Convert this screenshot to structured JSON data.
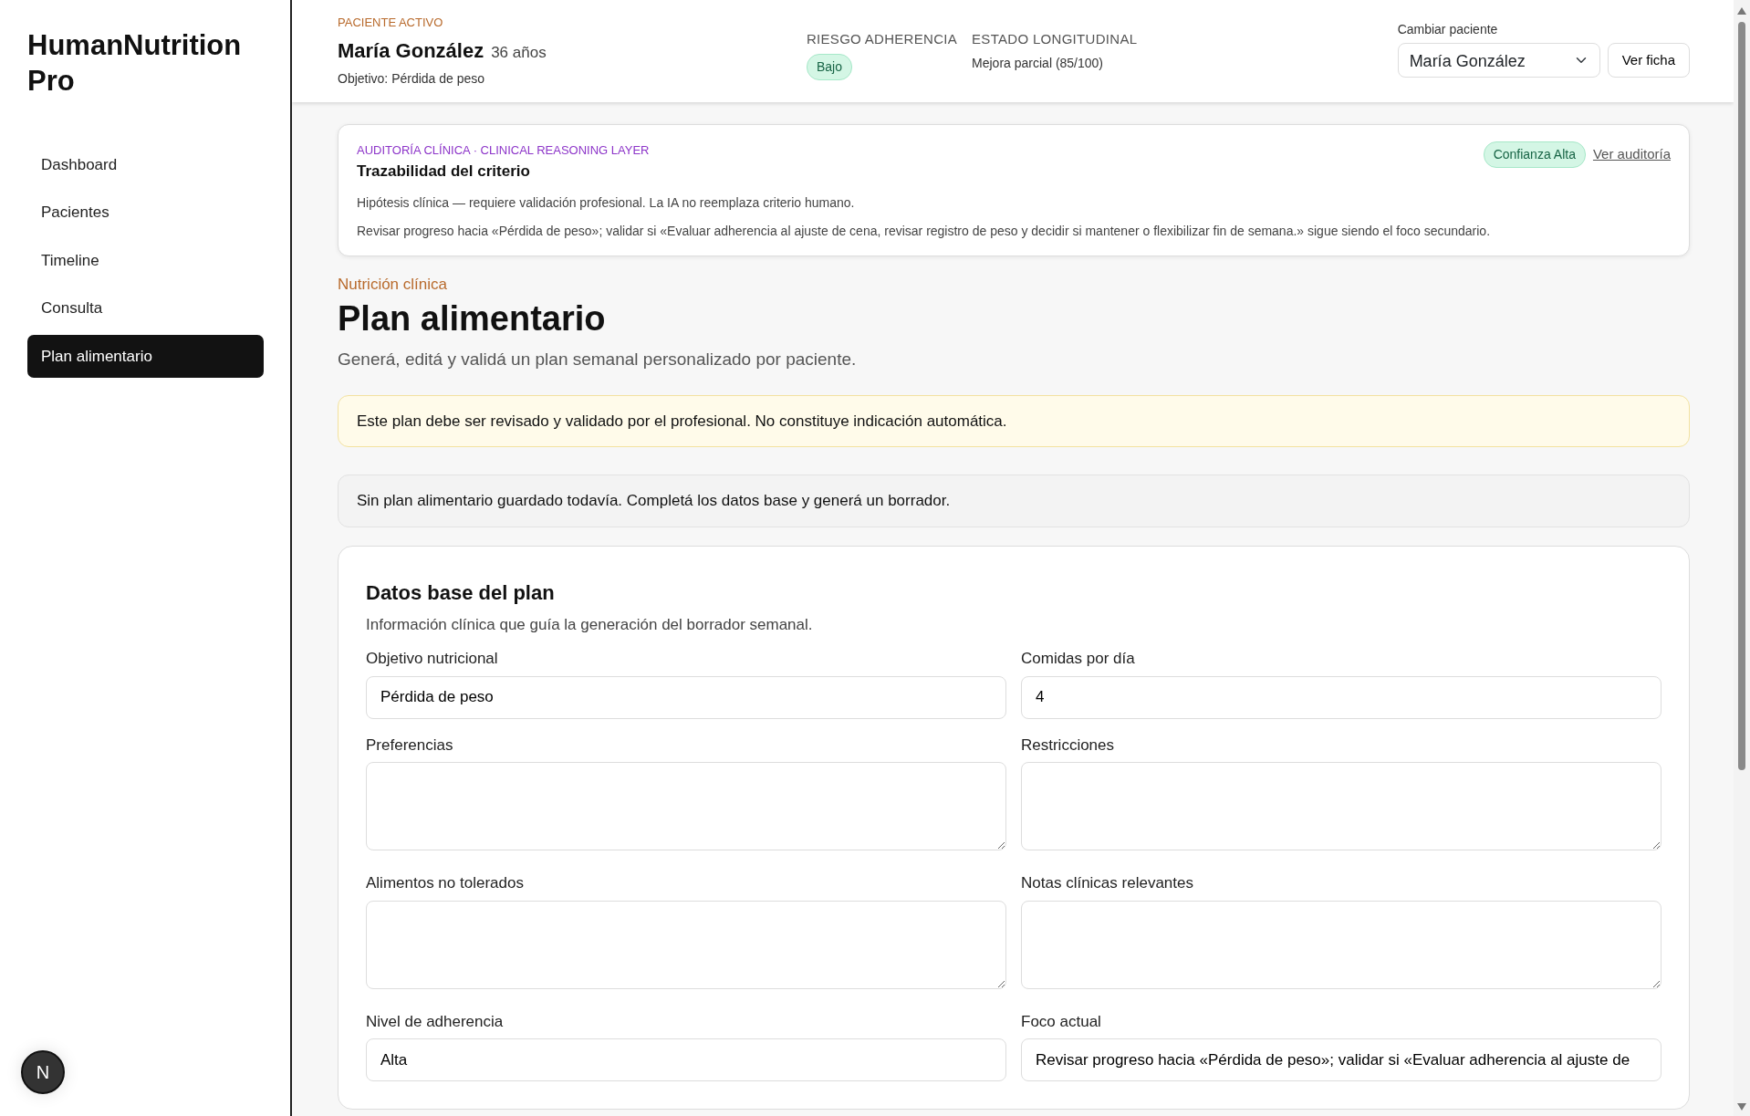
{
  "sidebar": {
    "brand": "HumanNutrition Pro",
    "items": [
      {
        "label": "Dashboard",
        "selected": false
      },
      {
        "label": "Pacientes",
        "selected": false
      },
      {
        "label": "Timeline",
        "selected": false
      },
      {
        "label": "Consulta",
        "selected": false
      },
      {
        "label": "Plan alimentario",
        "selected": true
      }
    ],
    "avatar": "N"
  },
  "header": {
    "eyebrow": "PACIENTE ACTIVO",
    "patient": "María González",
    "age": "36 años",
    "objective": "Objetivo: Pérdida de peso",
    "stats": [
      {
        "kind": "badge",
        "label": "RIESGO ADHERENCIA",
        "value": "Bajo"
      },
      {
        "kind": "text",
        "label": "ESTADO LONGITUDINAL",
        "value": "Mejora parcial (85/100)"
      }
    ],
    "switch_label": "Cambiar paciente",
    "switch_value": "María González",
    "view_button": "Ver ficha"
  },
  "audit": {
    "eyebrow": "AUDITORÍA CLÍNICA · CLINICAL REASONING LAYER",
    "title": "Trazabilidad del criterio",
    "badge": "Confianza Alta",
    "link": "Ver auditoría",
    "lines": [
      "Hipótesis clínica — requiere validación profesional. La IA no reemplaza criterio humano.",
      "Revisar progreso hacia «Pérdida de peso»; validar si «Evaluar adherencia al ajuste de cena, revisar registro de peso y decidir si mantener o flexibilizar fin de semana.» sigue siendo el foco secundario."
    ]
  },
  "page": {
    "eyebrow": "Nutrición clínica",
    "title": "Plan alimentario",
    "subtitle": "Generá, editá y validá un plan semanal personalizado por paciente."
  },
  "alerts": [
    {
      "kind": "warning",
      "text": "Este plan debe ser revisado y validado por el profesional. No constituye indicación automática."
    },
    {
      "kind": "info",
      "text": "Sin plan alimentario guardado todavía. Completá los datos base y generá un borrador."
    }
  ],
  "form": {
    "title": "Datos base del plan",
    "description": "Información clínica que guía la generación del borrador semanal.",
    "fields": [
      {
        "kind": "input",
        "label": "Objetivo nutricional",
        "value": "Pérdida de peso"
      },
      {
        "kind": "input",
        "label": "Comidas por día",
        "value": "4"
      },
      {
        "kind": "textarea",
        "label": "Preferencias"
      },
      {
        "kind": "textarea",
        "label": "Restricciones"
      },
      {
        "kind": "textarea",
        "label": "Alimentos no tolerados"
      },
      {
        "kind": "textarea",
        "label": "Notas clínicas relevantes"
      },
      {
        "kind": "input",
        "label": "Nivel de adherencia",
        "value": "Alta"
      },
      {
        "kind": "input",
        "label": "Foco actual",
        "value": "Revisar progreso hacia «Pérdida de peso»; validar si «Evaluar adherencia al ajuste de"
      }
    ]
  }
}
